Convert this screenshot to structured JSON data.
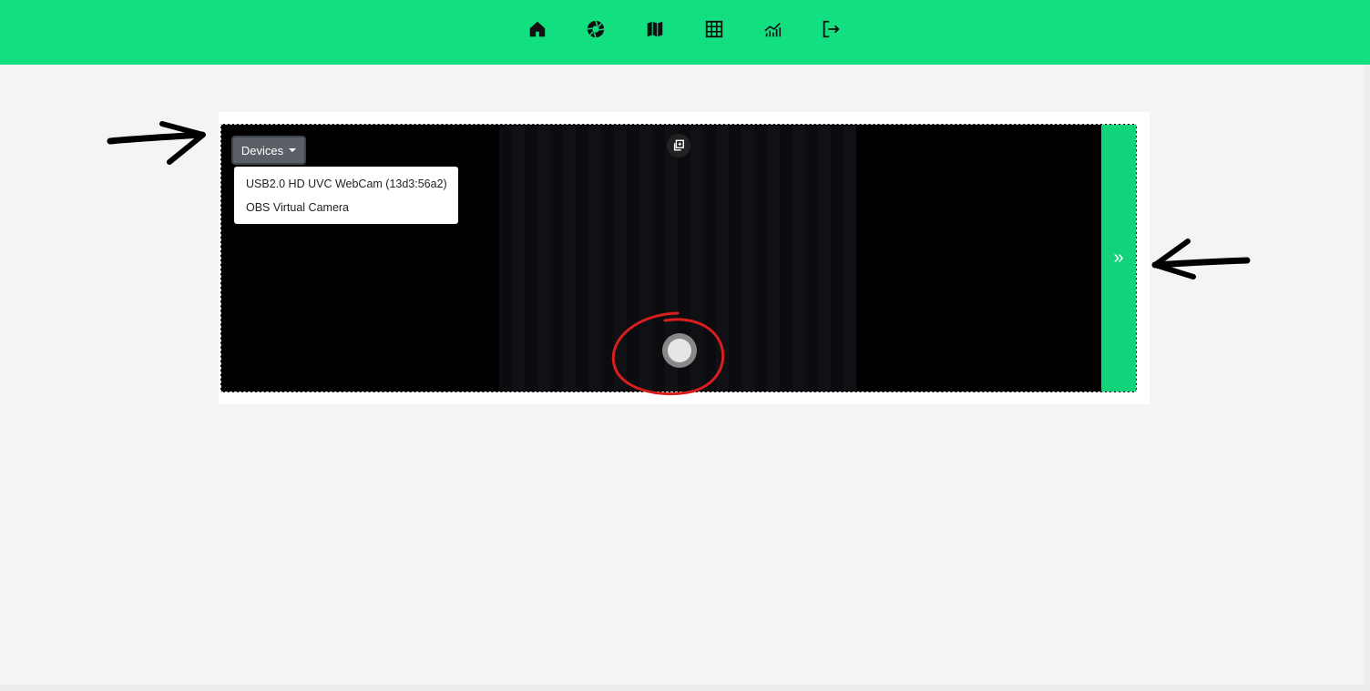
{
  "nav": {
    "icons": [
      "home-icon",
      "aperture-icon",
      "map-icon",
      "table-icon",
      "chart-icon",
      "logout-icon"
    ]
  },
  "camera": {
    "devices_label": "Devices",
    "device_options": [
      "USB2.0 HD UVC WebCam (13d3:56a2)",
      "OBS Virtual Camera"
    ],
    "side_panel_label": "»"
  },
  "colors": {
    "accent": "#12df80",
    "frame_bg": "#000000",
    "annotation_circle": "#d91e1e"
  }
}
